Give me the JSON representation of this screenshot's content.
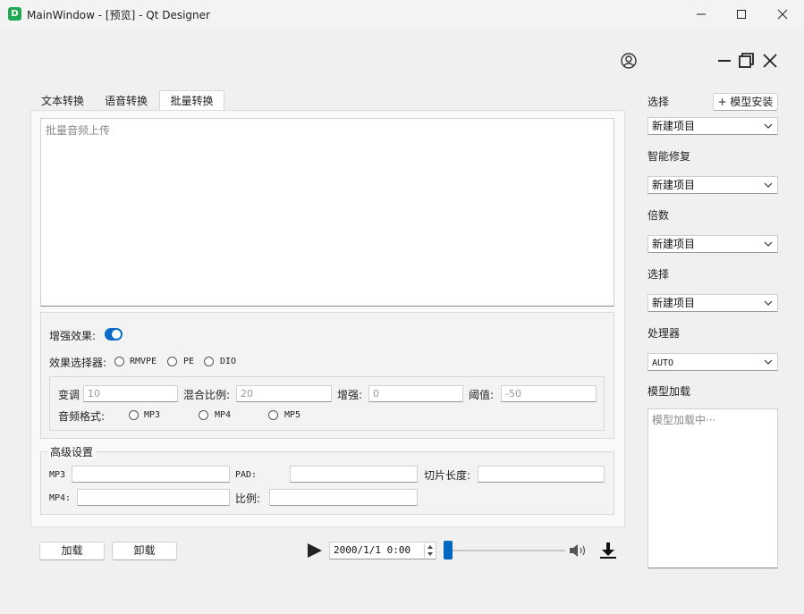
{
  "window": {
    "icon_letter": "D",
    "title": "MainWindow - [预览] - Qt Designer"
  },
  "tabs": [
    {
      "label": "文本转换",
      "active": false
    },
    {
      "label": "语音转换",
      "active": false
    },
    {
      "label": "批量转换",
      "active": true
    }
  ],
  "main": {
    "upload_placeholder": "批量音频上传",
    "enhance": {
      "label": "增强效果:",
      "toggle_on": true,
      "selector_label": "效果选择器:",
      "selector_options": [
        "RMVPE",
        "PE",
        "DIO"
      ],
      "fields": [
        {
          "label": "变调",
          "value": "10"
        },
        {
          "label": "混合比例:",
          "value": "20"
        },
        {
          "label": "增强:",
          "value": "0"
        },
        {
          "label": "阈值:",
          "value": "-50"
        }
      ],
      "format_label": "音频格式:",
      "format_options": [
        "MP3",
        "MP4",
        "MP5"
      ]
    },
    "advanced": {
      "title": "高级设置",
      "mp3_label": "MP3",
      "pad_label": "PAD:",
      "slice_label": "切片长度:",
      "mp4_label": "MP4:",
      "ratio_label": "比例:"
    }
  },
  "bottom": {
    "load_label": "加载",
    "unload_label": "卸载",
    "datetime": "2000/1/1 0:00",
    "progress": 0.0
  },
  "side": {
    "select1_label": "选择",
    "install_label": "+ 模型安装",
    "select1_value": "新建项目",
    "repair_label": "智能修复",
    "repair_value": "新建项目",
    "multiplier_label": "倍数",
    "multiplier_value": "新建项目",
    "select2_label": "选择",
    "select2_value": "新建项目",
    "processor_label": "处理器",
    "processor_value": "AUTO",
    "model_load_label": "模型加载",
    "model_log_placeholder": "模型加载中···"
  },
  "colors": {
    "accent": "#0067c0",
    "toggle": "#0a6cc8"
  }
}
